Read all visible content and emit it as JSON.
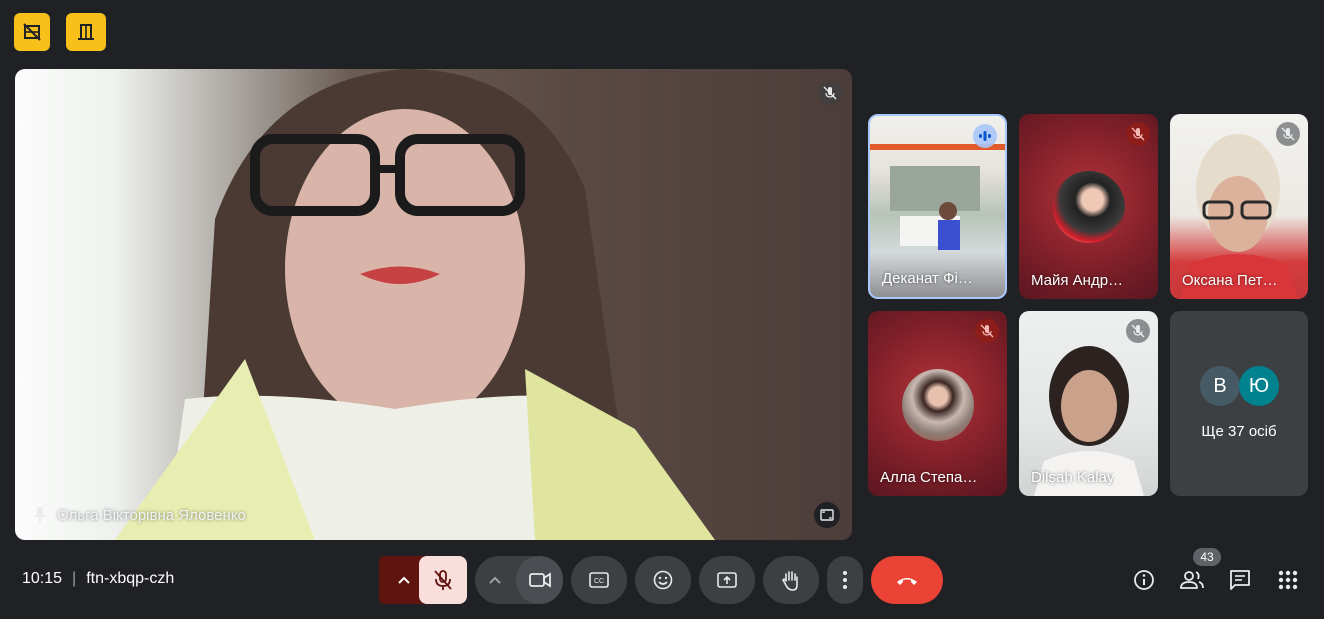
{
  "top_bar": {
    "icons": [
      "hide-tiles-icon",
      "door-icon"
    ],
    "accent": "#f9bf1b"
  },
  "main_video": {
    "speaker_name": "Ольга Вікторівна Яловенко",
    "icons": [
      "mic-off-icon",
      "pin-icon",
      "expand-icon"
    ]
  },
  "participants": [
    {
      "name": "Деканат Фі…",
      "speaking": true
    },
    {
      "name": "Майя Андр…",
      "muted": true
    },
    {
      "name": "Оксана Пет…",
      "muted": true
    },
    {
      "name": "Алла Степа…",
      "muted": true
    },
    {
      "name": "Dilşah Kalay",
      "muted": true
    }
  ],
  "others": {
    "initials": [
      "В",
      "Ю"
    ],
    "label": "Ще 37 осіб",
    "colors": [
      "#455a64",
      "#00838f"
    ]
  },
  "footer": {
    "time": "10:15",
    "separator": "|",
    "meeting_code": "ftn-xbqp-czh",
    "participants_count": "43",
    "end_call_color": "#ea4335",
    "mic_off_bg": "#f9dedc"
  }
}
